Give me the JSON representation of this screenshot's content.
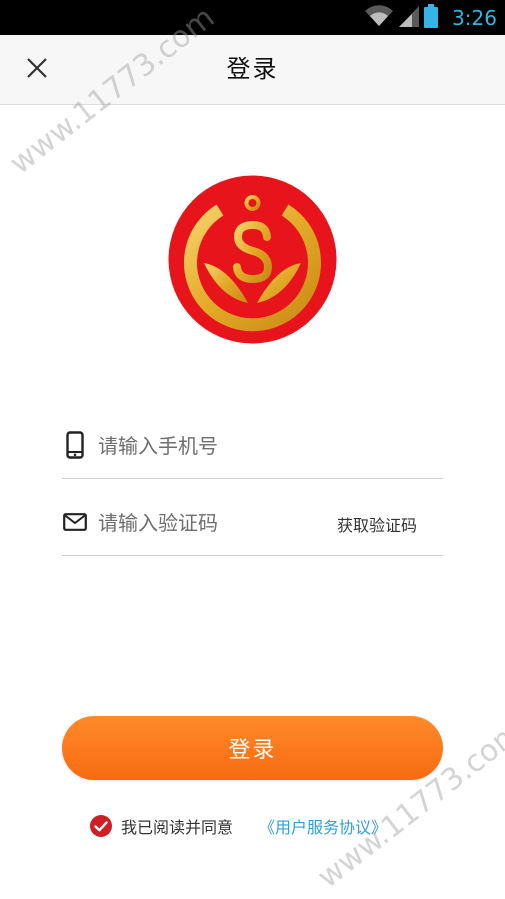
{
  "status_bar": {
    "time": "3:26",
    "icons": [
      "wifi-icon",
      "signal-icon",
      "battery-icon"
    ],
    "time_color": "#33b5e5"
  },
  "header": {
    "title": "登录",
    "close_icon": "close-icon"
  },
  "logo": {
    "icon": "dollar-coin-logo",
    "colors": {
      "outer": "#e8141c",
      "gold": "#e9b33a"
    }
  },
  "form": {
    "phone": {
      "placeholder": "请输入手机号",
      "value": "",
      "icon": "phone-icon"
    },
    "code": {
      "placeholder": "请输入验证码",
      "value": "",
      "icon": "mail-icon",
      "action_label": "获取验证码"
    }
  },
  "login_button": {
    "label": "登录",
    "color": "#f77a1a"
  },
  "agreement": {
    "checked": true,
    "text": "我已阅读并同意",
    "link_text": "《用户服务协议》",
    "check_color": "#cf1f25",
    "link_color": "#2f9ee0"
  },
  "watermark": {
    "text": "www.11773.com"
  }
}
